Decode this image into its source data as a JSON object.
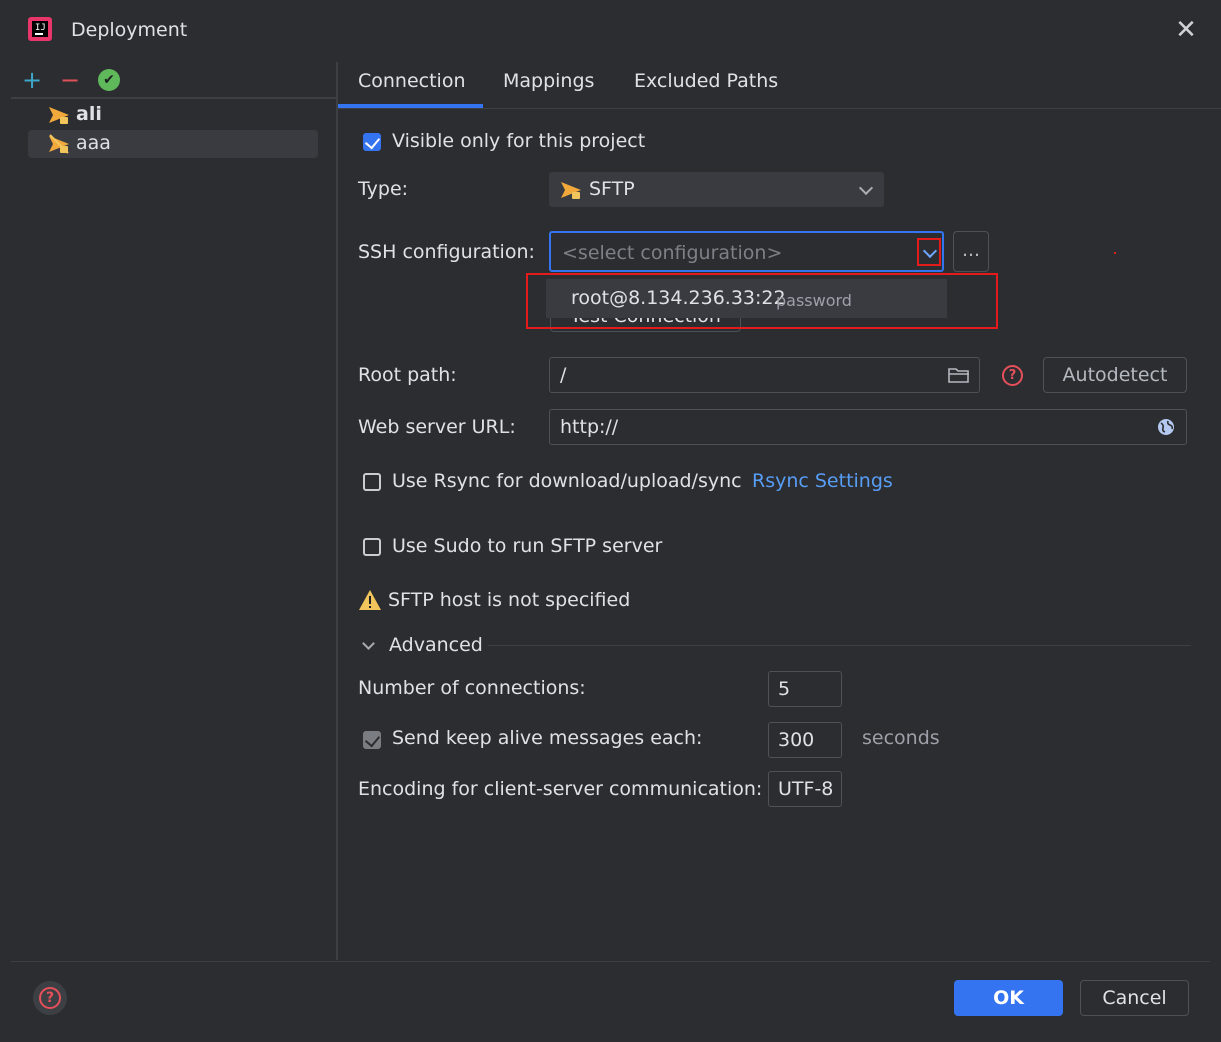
{
  "window": {
    "title": "Deployment"
  },
  "toolbar": {
    "add": "+",
    "remove": "−"
  },
  "servers": [
    {
      "name": "ali",
      "selected": false
    },
    {
      "name": "aaa",
      "selected": true
    }
  ],
  "tabs": [
    "Connection",
    "Mappings",
    "Excluded Paths"
  ],
  "connection": {
    "visible_only_label": "Visible only for this project",
    "type_label": "Type:",
    "type_value": "SFTP",
    "ssh_label": "SSH configuration:",
    "ssh_placeholder": "<select configuration>",
    "ssh_more_button": "...",
    "ssh_option_host": "root@8.134.236.33:22",
    "ssh_option_auth": "password",
    "test_connection_button": "Test Connection",
    "root_path_label": "Root path:",
    "root_path_value": "/",
    "autodetect_button": "Autodetect",
    "web_url_label": "Web server URL:",
    "web_url_value": "http://",
    "rsync_label": "Use Rsync for download/upload/sync",
    "rsync_settings_link": "Rsync Settings",
    "sudo_label": "Use Sudo to run SFTP server",
    "warning_text": "SFTP host is not specified"
  },
  "advanced": {
    "header": "Advanced",
    "num_connections_label": "Number of connections:",
    "num_connections_value": "5",
    "keepalive_label": "Send keep alive messages each:",
    "keepalive_value": "300",
    "keepalive_unit": "seconds",
    "encoding_label": "Encoding for client-server communication:",
    "encoding_value": "UTF-8"
  },
  "footer": {
    "ok": "OK",
    "cancel": "Cancel"
  },
  "colors": {
    "accent": "#3574f0",
    "warning": "#f2c55c",
    "error": "#e5505a",
    "highlight": "#e31b1b"
  }
}
